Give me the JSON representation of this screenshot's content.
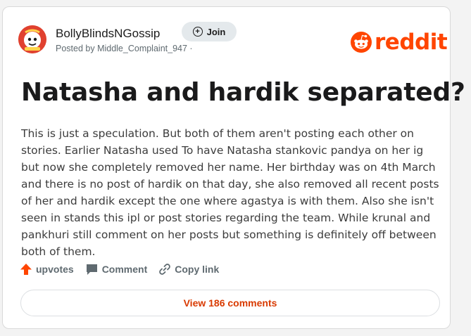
{
  "header": {
    "subreddit_name": "BollyBlindsNGossip",
    "posted_by": "Posted by Middle_Complaint_947 ·",
    "join_label": "Join",
    "avatar_icon": "subreddit-avatar-icon",
    "brand": {
      "wordmark": "reddit",
      "color": "#ff4500",
      "icon": "reddit-snoo-icon"
    }
  },
  "post": {
    "title": "Natasha and hardik separated?",
    "body": "This is just a speculation. But both of them aren't posting each other on stories. Earlier Natasha used To have Natasha stankovic pandya on her ig but now she completely removed her name. Her birthday was on 4th March and there is no post of hardik on that day, she also removed all recent posts of her and hardik except the one where agastya is with them. Also she isn't seen in stands this ipl or post stories regarding the team. While krunal and pankhuri still comment on her posts but something is definitely off between both of them."
  },
  "actions": {
    "upvotes_label": "upvotes",
    "comment_label": "Comment",
    "copy_link_label": "Copy link",
    "upvote_icon": "upvote-arrow-icon",
    "comment_icon": "comment-bubble-icon",
    "link_icon": "link-icon",
    "upvote_color": "#ff4500"
  },
  "footer": {
    "view_comments_label": "View 186 comments",
    "accent_color": "#d93a00"
  }
}
